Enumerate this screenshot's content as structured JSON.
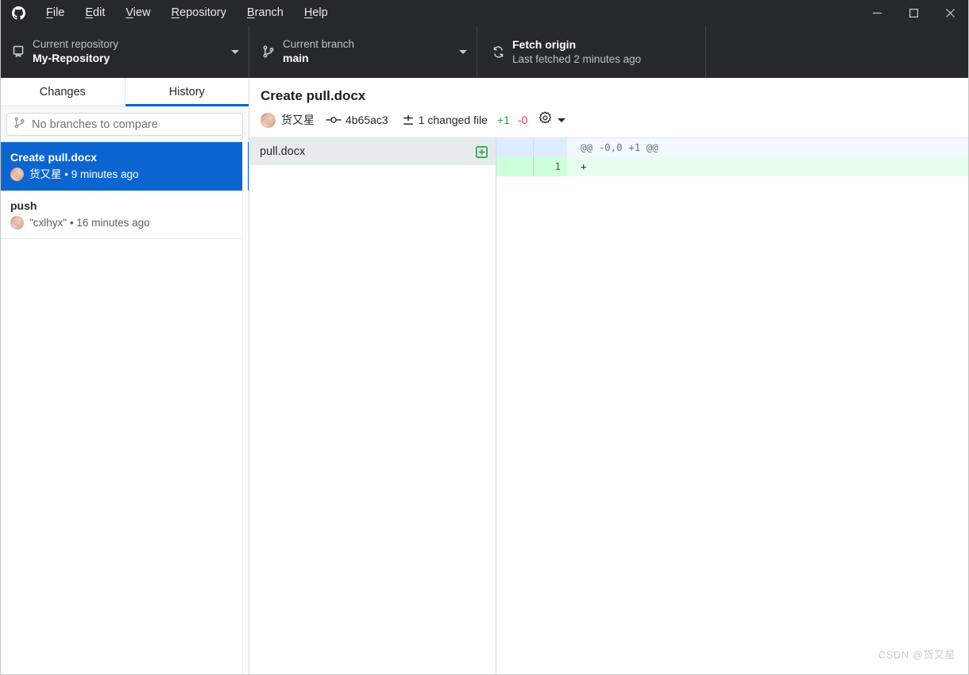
{
  "titlebar": {
    "logo_icon": "github-logo-icon",
    "menu": [
      {
        "label": "File",
        "mnemonic": "F"
      },
      {
        "label": "Edit",
        "mnemonic": "E"
      },
      {
        "label": "View",
        "mnemonic": "V"
      },
      {
        "label": "Repository",
        "mnemonic": "R"
      },
      {
        "label": "Branch",
        "mnemonic": "B"
      },
      {
        "label": "Help",
        "mnemonic": "H"
      }
    ],
    "window_controls": {
      "minimize": "minimize-icon",
      "maximize": "maximize-icon",
      "close": "close-icon"
    }
  },
  "toolbar": {
    "repository": {
      "icon": "repo-icon",
      "label": "Current repository",
      "value": "My-Repository"
    },
    "branch": {
      "icon": "git-branch-icon",
      "label": "Current branch",
      "value": "main"
    },
    "fetch": {
      "icon": "sync-icon",
      "label": "Fetch origin",
      "value": "Last fetched 2 minutes ago"
    }
  },
  "sidebar": {
    "tabs": [
      {
        "label": "Changes",
        "active": false
      },
      {
        "label": "History",
        "active": true
      }
    ],
    "compare": {
      "icon": "git-branch-icon",
      "placeholder": "No branches to compare"
    },
    "commits": [
      {
        "title": "Create pull.docx",
        "author": "货又星",
        "separator": "•",
        "time": "9 minutes ago",
        "selected": true
      },
      {
        "title": "push",
        "author": "\"cxlhyx\"",
        "separator": "•",
        "time": "16 minutes ago",
        "selected": false
      }
    ]
  },
  "commit_summary": {
    "title": "Create pull.docx",
    "author": "货又星",
    "sha": "4b65ac3",
    "sha_icon": "git-commit-icon",
    "diff_icon": "diff-icon",
    "changed_files": "1 changed file",
    "additions": "+1",
    "deletions": "-0",
    "gear_icon": "gear-icon",
    "caret_icon": "chevron-down-icon"
  },
  "file_list": [
    {
      "name": "pull.docx",
      "status": "added",
      "status_icon": "plus-box-icon",
      "selected": true
    }
  ],
  "diff": {
    "rows": [
      {
        "type": "hunk",
        "old_line": "",
        "new_line": "",
        "content": "@@ -0,0 +1 @@"
      },
      {
        "type": "add",
        "old_line": "",
        "new_line": "1",
        "content": "+"
      }
    ]
  },
  "watermark": "CSDN @货又星",
  "colors": {
    "titlebar_bg": "#24292e",
    "accent_blue": "#0366d6",
    "selected_commit_bg": "#0b65d0",
    "addition_green": "#28a745",
    "deletion_red": "#d73a49",
    "diff_add_bg": "#e6ffed",
    "diff_hunk_bg": "#f1f8ff"
  }
}
